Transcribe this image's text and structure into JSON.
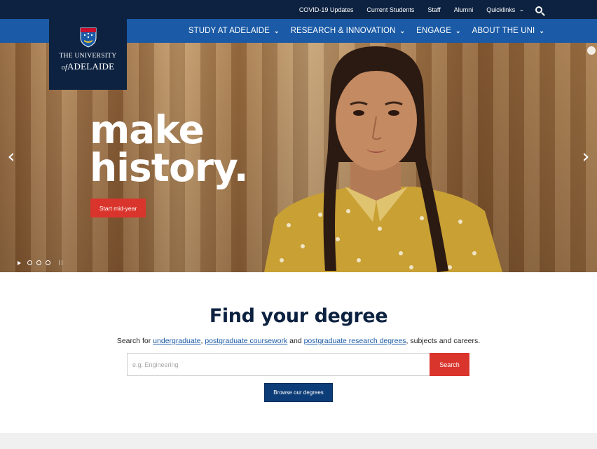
{
  "utility": {
    "links": [
      "COVID-19 Updates",
      "Current Students",
      "Staff",
      "Alumni"
    ],
    "quicklinks_label": "Quicklinks",
    "search_icon": "search-icon"
  },
  "nav": {
    "items": [
      {
        "label": "STUDY AT ADELAIDE"
      },
      {
        "label": "RESEARCH & INNOVATION"
      },
      {
        "label": "ENGAGE"
      },
      {
        "label": "ABOUT THE UNI"
      }
    ],
    "chevron_icon": "chevron-down-icon"
  },
  "logo": {
    "line1": "THE UNIVERSITY",
    "of": "of",
    "line2": "ADELAIDE",
    "crest_icon": "crest-icon"
  },
  "hero": {
    "headline_line1": "make",
    "headline_line2": "history.",
    "cta_label": "Start mid-year",
    "prev_icon": "chevron-left-icon",
    "next_icon": "chevron-right-icon",
    "slide_count": 3,
    "active_slide": 1
  },
  "finder": {
    "title": "Find your degree",
    "desc_prefix": "Search for ",
    "link1": "undergraduate",
    "sep1": ", ",
    "link2": "postgraduate coursework",
    "sep2": " and ",
    "link3": "postgraduate research degrees",
    "desc_suffix": ", subjects and careers.",
    "search_placeholder": "e.g. Engineering",
    "search_value": "",
    "search_button": "Search",
    "browse_button": "Browse our degrees"
  },
  "colors": {
    "navy": "#0d2240",
    "blue": "#1a5aa6",
    "red": "#d9352c"
  }
}
